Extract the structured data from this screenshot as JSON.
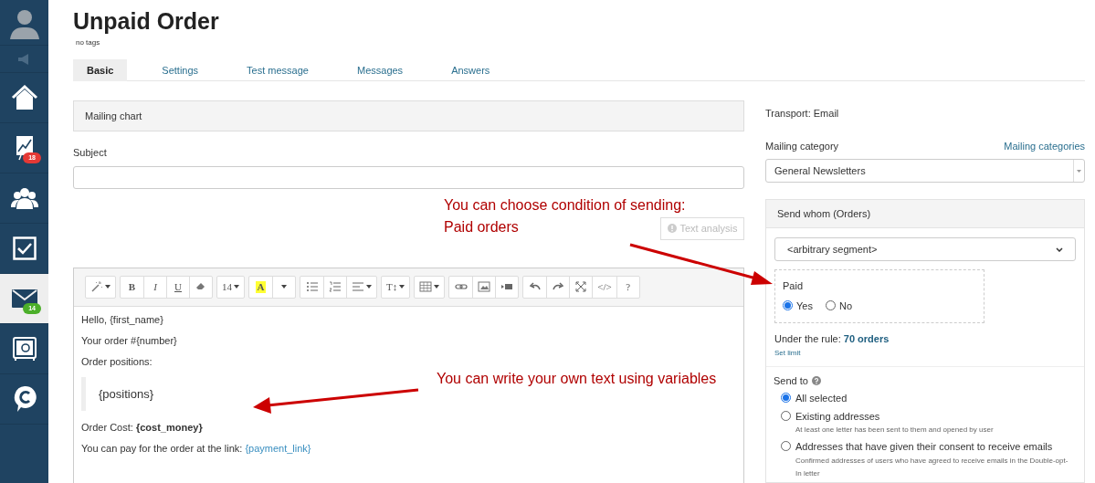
{
  "sidebar": {
    "items": [
      {
        "kind": "avatar",
        "selected": false
      },
      {
        "kind": "speaker",
        "selected": false
      },
      {
        "kind": "home",
        "selected": false
      },
      {
        "kind": "chart",
        "selected": false,
        "badge": "18",
        "color": "#e53935"
      },
      {
        "kind": "people",
        "selected": false
      },
      {
        "kind": "check",
        "selected": false
      },
      {
        "kind": "mail",
        "selected": true,
        "badge": "14",
        "color": "#4caf2a"
      },
      {
        "kind": "safe",
        "selected": false
      },
      {
        "kind": "chat",
        "selected": false
      }
    ]
  },
  "page": {
    "title": "Unpaid Order",
    "tags": "no tags"
  },
  "tabs": [
    {
      "label": "Basic",
      "selected": true
    },
    {
      "label": "Settings",
      "selected": false
    },
    {
      "label": "Test message",
      "selected": false
    },
    {
      "label": "Messages",
      "selected": false
    },
    {
      "label": "Answers",
      "selected": false
    }
  ],
  "mailing_chart": "Mailing chart",
  "subject": {
    "label": "Subject"
  },
  "text_analysis": "Text analysis",
  "toolbar": [
    [
      {
        "kind": "magic",
        "caret": true
      }
    ],
    [
      {
        "kind": "bold",
        "label": "B"
      },
      {
        "kind": "italic",
        "label": "I"
      },
      {
        "kind": "underline",
        "label": "U"
      },
      {
        "kind": "eraser"
      }
    ],
    [
      {
        "kind": "text",
        "label": "14",
        "caret": true
      }
    ],
    [
      {
        "kind": "highlight",
        "label": "A"
      },
      {
        "kind": "caret"
      }
    ],
    [
      {
        "kind": "ul"
      },
      {
        "kind": "ol"
      },
      {
        "kind": "align",
        "caret": true
      }
    ],
    [
      {
        "kind": "text",
        "label": "T↕",
        "caret": true
      }
    ],
    [
      {
        "kind": "table",
        "caret": true
      }
    ],
    [
      {
        "kind": "link"
      },
      {
        "kind": "image"
      },
      {
        "kind": "video"
      }
    ],
    [
      {
        "kind": "undo"
      },
      {
        "kind": "redo"
      },
      {
        "kind": "fullscreen"
      },
      {
        "kind": "text",
        "label": "</>"
      },
      {
        "kind": "text",
        "label": "?"
      }
    ]
  ],
  "editor_lines": [
    {
      "kind": "p",
      "text": "Hello, {first_name}"
    },
    {
      "kind": "p",
      "text": "Your order #{number}"
    },
    {
      "kind": "p",
      "text": "Order positions:"
    },
    {
      "kind": "quote",
      "text": "{positions}"
    },
    {
      "kind": "p",
      "text": "Order Cost: **{cost_money}**"
    },
    {
      "kind": "p",
      "text": "You can pay for the order at the link: ",
      "link": "{payment_link}"
    }
  ],
  "right": {
    "transport": "Transport: Email",
    "category_label": "Mailing category",
    "category_link": "Mailing categories",
    "category_value": "General Newsletters",
    "send_whom": {
      "title": "Send whom (Orders)",
      "segment": "<arbitrary segment>",
      "paid_label": "Paid",
      "paid_options": [
        {
          "label": "Yes",
          "selected": true
        },
        {
          "label": "No",
          "selected": false
        }
      ],
      "rule_text": "Under the rule: ",
      "rule_count": "70 orders",
      "set_limit": "Set limit"
    },
    "send_to": {
      "title": "Send to",
      "options": [
        {
          "label": "All selected",
          "selected": true
        },
        {
          "label": "Existing addresses",
          "selected": false,
          "hint": "At least one letter has been sent to them and opened by user"
        },
        {
          "label": "Addresses that have given their consent to receive emails",
          "selected": false,
          "hint": "Confirmed addresses of users who have agreed to receive emails in the Double-opt-In letter"
        }
      ]
    }
  },
  "annotations": [
    {
      "lines": [
        "You can choose condition of sending:",
        "Paid orders"
      ]
    },
    {
      "lines": [
        "You can write your own text using variables"
      ]
    }
  ]
}
